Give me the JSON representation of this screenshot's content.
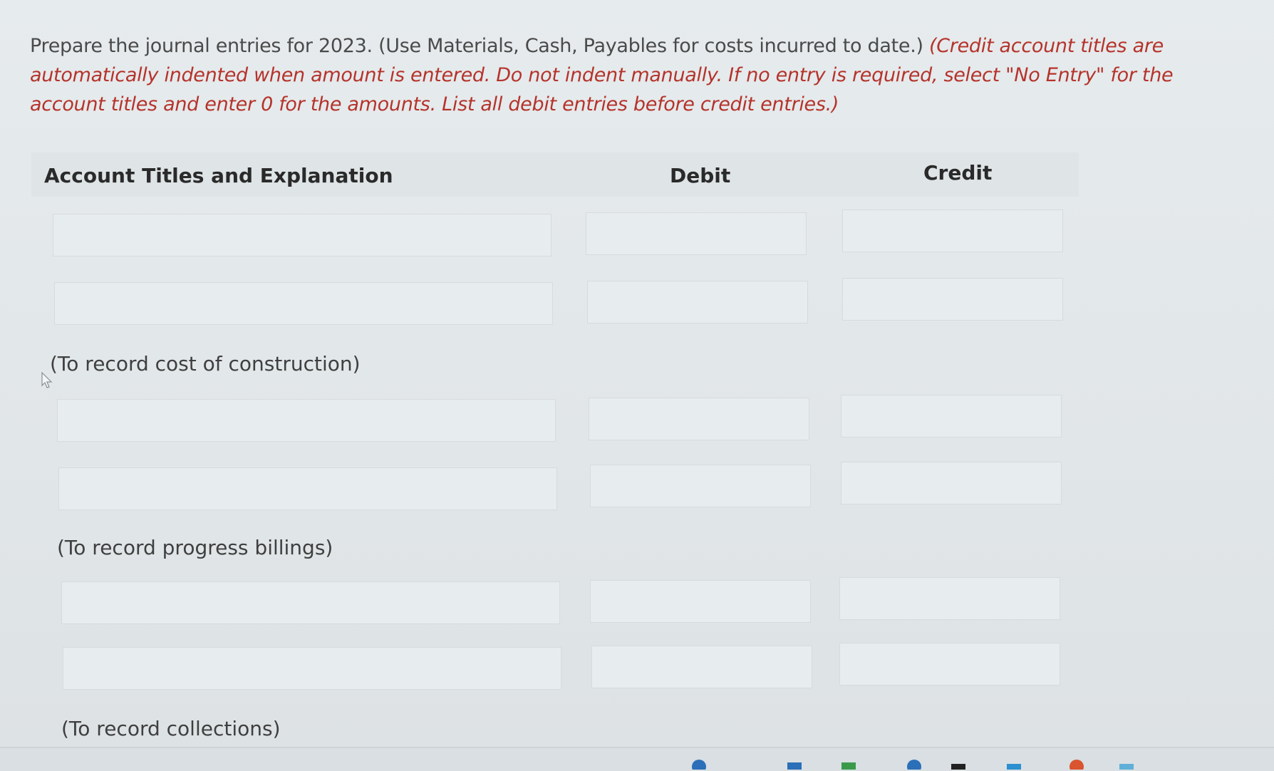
{
  "instructions": {
    "lead": "Prepare the journal entries for 2023. (Use Materials, Cash, Payables for costs incurred to date.)",
    "note": "(Credit account titles are automatically indented when amount is entered. Do not indent manually. If no entry is required, select \"No Entry\" for the account titles and enter 0 for the amounts. List all debit entries before credit entries.)"
  },
  "table": {
    "col_account": "Account Titles and Explanation",
    "col_debit": "Debit",
    "col_credit": "Credit"
  },
  "entries": [
    {
      "explanation": "(To record cost of construction)"
    },
    {
      "explanation": "(To record progress billings)"
    },
    {
      "explanation": "(To record collections)"
    }
  ]
}
